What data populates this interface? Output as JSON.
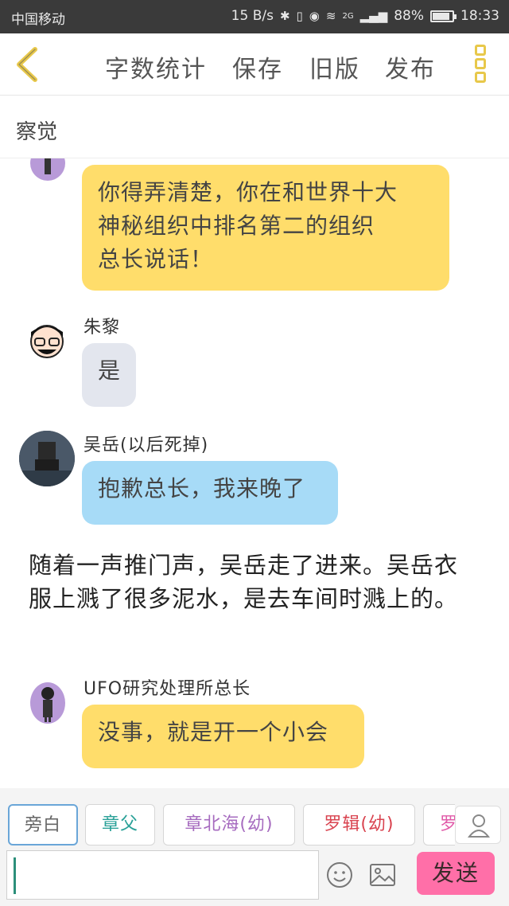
{
  "status_bar": {
    "carrier": "中国移动",
    "speed": "15 B/s",
    "network": "2G",
    "battery": "88%",
    "battery_level": 0.88,
    "time": "18:33"
  },
  "toolbar": {
    "back_icon": "chevron-left-icon",
    "word_count": "字数统计",
    "save": "保存",
    "old_version": "旧版",
    "publish": "发布",
    "menu_icon": "more-vertical-icon",
    "accent": "#e8c84a"
  },
  "chapter": {
    "title": "察觉"
  },
  "messages": [
    {
      "sender": "",
      "text": "你得弄清楚，你在和世界十大神秘组织中排名第二的组织总长说话！",
      "lines": [
        "你得弄清楚，你在和世界十大",
        "神秘组织中排名第二的组织",
        "总长说话！"
      ],
      "color": "#ffdd6b"
    },
    {
      "sender": "朱黎",
      "text": "是",
      "color": "#e3e6ee"
    },
    {
      "sender": "吴岳(以后死掉)",
      "text": "抱歉总长，我来晚了",
      "color": "#a7dbf7"
    },
    {
      "sender": "UFO研究处理所总长",
      "text": "没事，就是开一个小会",
      "color": "#ffdd6b"
    }
  ],
  "narration": "随着一声推门声，吴岳走了进来。吴岳衣服上溅了很多泥水，是去车间时溅上的。",
  "characters": [
    {
      "label": "旁白",
      "color": "#666666"
    },
    {
      "label": "章父",
      "color": "#2aa198"
    },
    {
      "label": "章北海(幼)",
      "color": "#a66bbf"
    },
    {
      "label": "罗辑(幼)",
      "color": "#d9434f"
    },
    {
      "label": "罗",
      "color": "#e05aa8"
    }
  ],
  "composer": {
    "input_value": "",
    "emoji_icon": "emoji-icon",
    "image_icon": "image-icon",
    "role_icon": "user-icon",
    "send": "发送",
    "send_color": "#ff6fa8"
  }
}
